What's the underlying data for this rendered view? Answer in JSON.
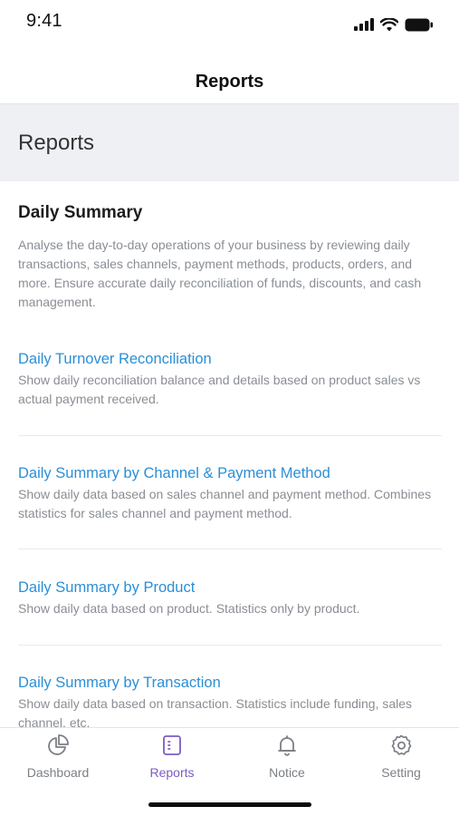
{
  "status_bar": {
    "time": "9:41"
  },
  "nav": {
    "title": "Reports"
  },
  "section": {
    "title": "Reports"
  },
  "group": {
    "title": "Daily Summary",
    "description": "Analyse the day-to-day operations of your business by reviewing daily transactions, sales channels, payment methods, products, orders, and more. Ensure accurate daily reconciliation of funds, discounts, and cash management."
  },
  "reports": [
    {
      "title": "Daily Turnover Reconciliation",
      "description": "Show daily reconciliation balance and details based on product sales vs actual payment received."
    },
    {
      "title": "Daily Summary by Channel & Payment Method",
      "description": "Show daily data based on sales channel and payment method. Combines statistics for sales channel and payment method."
    },
    {
      "title": "Daily Summary by Product",
      "description": "Show daily data based on product. Statistics only by product."
    },
    {
      "title": "Daily Summary by Transaction",
      "description": "Show daily data based on transaction. Statistics include funding, sales channel, etc."
    }
  ],
  "tabs": [
    {
      "label": "Dashboard",
      "icon": "pie-chart-icon",
      "active": false
    },
    {
      "label": "Reports",
      "icon": "report-icon",
      "active": true
    },
    {
      "label": "Notice",
      "icon": "bell-icon",
      "active": false
    },
    {
      "label": "Setting",
      "icon": "gear-icon",
      "active": false
    }
  ],
  "colors": {
    "accent": "#7c5cc4",
    "link": "#2b8fd6",
    "muted": "#8a8e94",
    "header_bg": "#eef0f3"
  }
}
